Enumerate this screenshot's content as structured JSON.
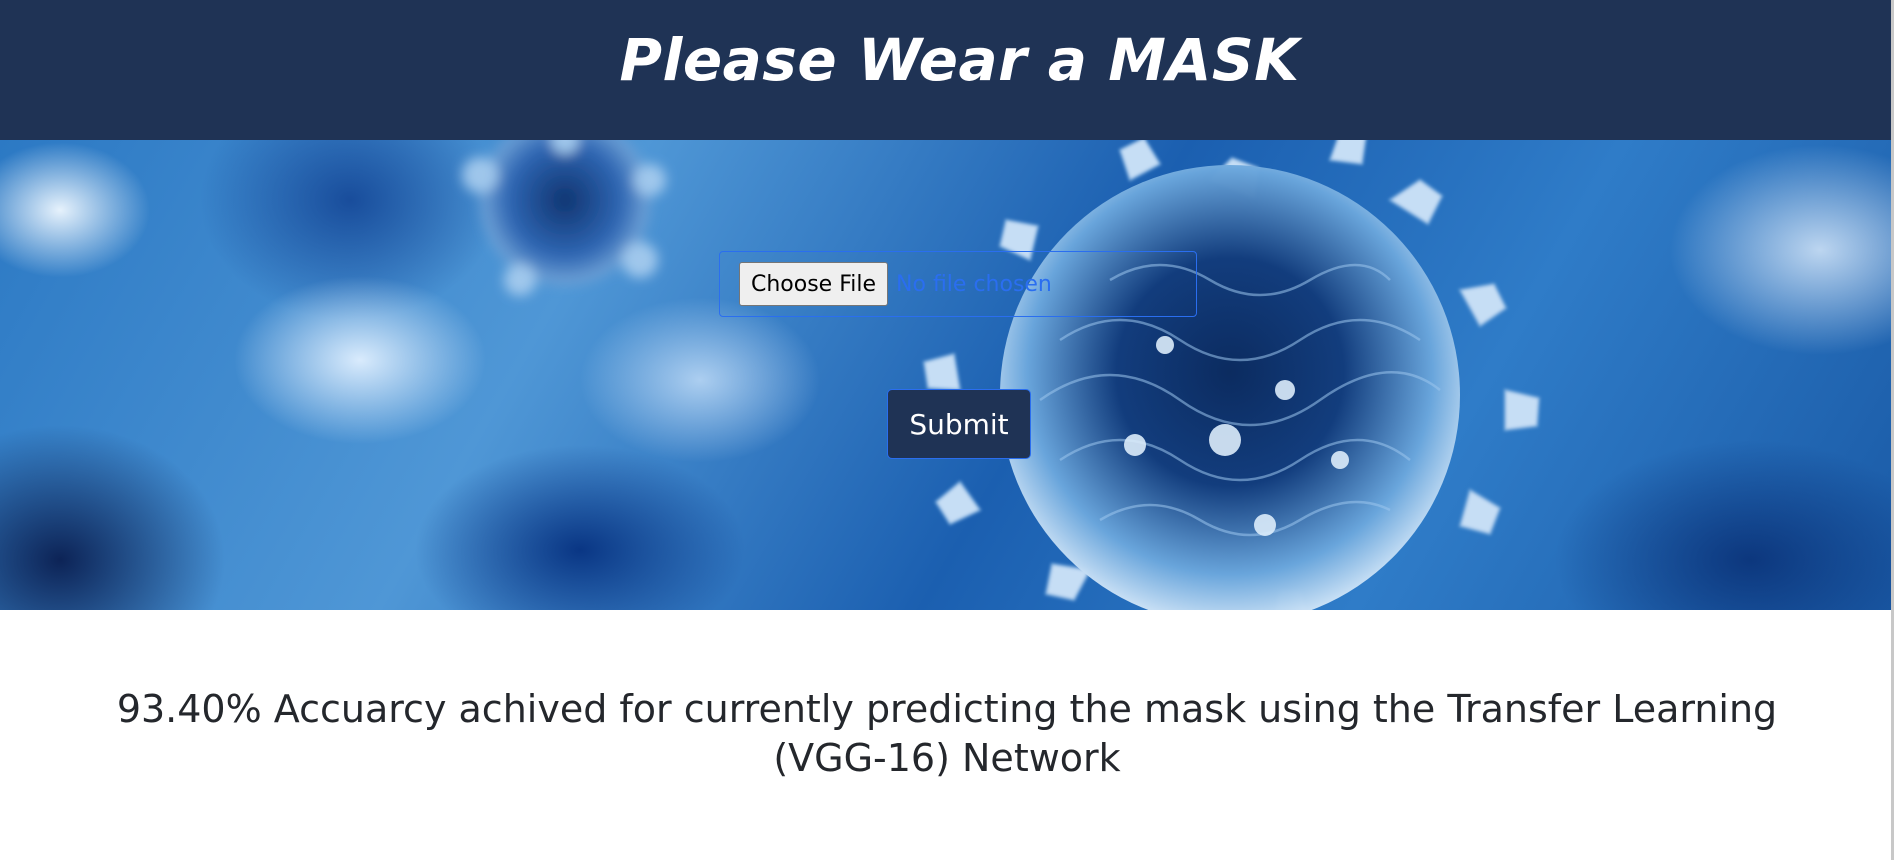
{
  "header": {
    "title": "Please Wear a MASK"
  },
  "upload": {
    "choose_file_label": "Choose File",
    "file_status": "No file chosen",
    "submit_label": "Submit"
  },
  "result": {
    "accuracy_text": "93.40% Accuarcy achived for currently predicting the mask using the Transfer Learning (VGG-16) Network"
  },
  "colors": {
    "header_bg": "#1f3355",
    "submit_bg": "#1f3355",
    "link_blue": "#2a6ef0",
    "text_dark": "#24272c"
  }
}
